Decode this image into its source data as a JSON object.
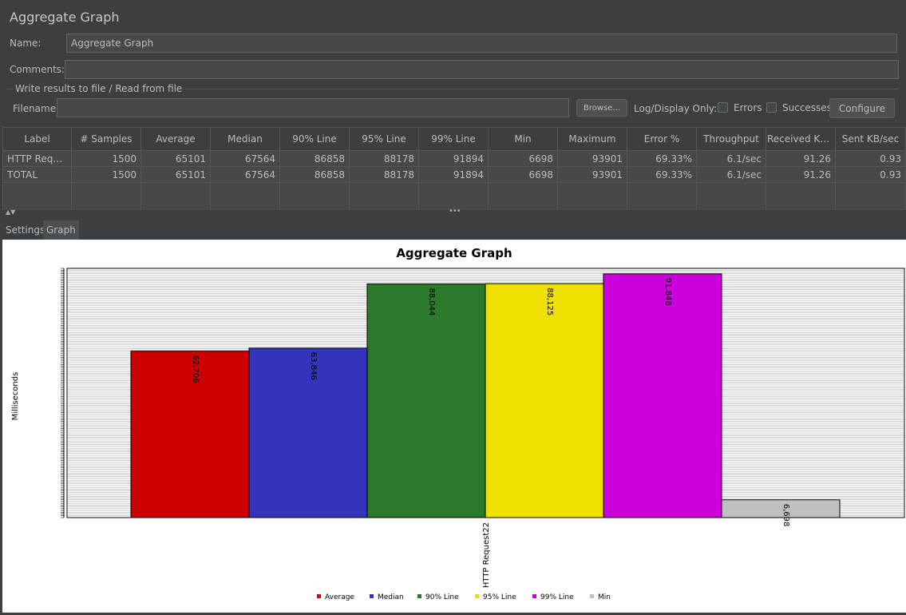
{
  "header": {
    "title": "Aggregate Graph"
  },
  "form": {
    "name_label": "Name:",
    "name_value": "Aggregate Graph",
    "comments_label": "Comments:",
    "comments_value": "",
    "file_group_title": "Write results to file / Read from file",
    "filename_label": "Filename",
    "filename_value": "",
    "browse_label": "Browse...",
    "log_display_label": "Log/Display Only:",
    "errors_label": "Errors",
    "successes_label": "Successes",
    "configure_label": "Configure"
  },
  "table": {
    "columns": [
      "Label",
      "# Samples",
      "Average",
      "Median",
      "90% Line",
      "95% Line",
      "99% Line",
      "Min",
      "Maximum",
      "Error %",
      "Throughput",
      "Received KB/...",
      "Sent KB/sec"
    ],
    "rows": [
      [
        "HTTP Reque...",
        "1500",
        "65101",
        "67564",
        "86858",
        "88178",
        "91894",
        "6698",
        "93901",
        "69.33%",
        "6.1/sec",
        "91.26",
        "0.93"
      ],
      [
        "TOTAL",
        "1500",
        "65101",
        "67564",
        "86858",
        "88178",
        "91894",
        "6698",
        "93901",
        "69.33%",
        "6.1/sec",
        "91.26",
        "0.93"
      ]
    ]
  },
  "tabs": [
    {
      "label": "Settings",
      "active": false
    },
    {
      "label": "Graph",
      "active": true
    }
  ],
  "chart_data": {
    "type": "bar",
    "title": "Aggregate Graph",
    "ylabel": "Milliseconds",
    "xlabel": "",
    "categories": [
      "HTTP Request22"
    ],
    "ylim": [
      0,
      93901
    ],
    "grid": true,
    "legend_position": "bottom",
    "series": [
      {
        "name": "Average",
        "values": [
          62706
        ],
        "color": "#cc0000",
        "label": "62,706"
      },
      {
        "name": "Median",
        "values": [
          63846
        ],
        "color": "#3333bb",
        "label": "63,846"
      },
      {
        "name": "90% Line",
        "values": [
          88044
        ],
        "color": "#2b7a2b",
        "label": "88,044"
      },
      {
        "name": "95% Line",
        "values": [
          88125
        ],
        "color": "#f0e000",
        "label": "88,125"
      },
      {
        "name": "99% Line",
        "values": [
          91848
        ],
        "color": "#cc00dd",
        "label": "91,848"
      },
      {
        "name": "Min",
        "values": [
          6698
        ],
        "color": "#c0c0c0",
        "label": "6,698"
      }
    ]
  }
}
